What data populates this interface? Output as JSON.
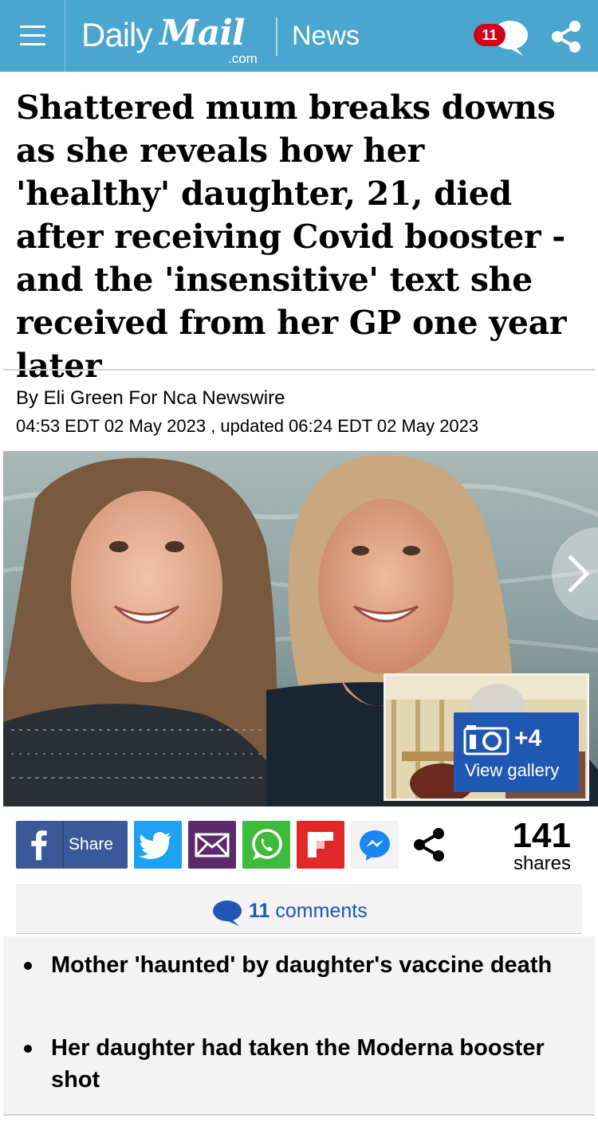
{
  "header": {
    "logo_daily": "Daily",
    "logo_mail": "Mail",
    "logo_com": ".com",
    "section": "News",
    "comment_count": "11",
    "brand_color": "#4aa6cf"
  },
  "article": {
    "headline": "Shattered mum breaks downs as she reveals how her 'healthy' daughter, 21, died after receiving Covid booster - and the 'insensitive' text she received from her GP one year later",
    "byline": "By Eli Green For Nca Newswire",
    "dateline": "04:53 EDT 02 May 2023 , updated 06:24 EDT 02 May 2023"
  },
  "gallery": {
    "extra_count": "+4",
    "label": "View gallery"
  },
  "share_bar": {
    "facebook_label": "Share",
    "share_count": "141",
    "share_word": "shares",
    "icons": [
      "facebook-icon",
      "twitter-icon",
      "email-icon",
      "whatsapp-icon",
      "flipboard-icon",
      "messenger-icon",
      "share-icon"
    ]
  },
  "comments": {
    "count": "11",
    "word": "comments"
  },
  "bullets": [
    "Mother 'haunted' by daughter's vaccine death",
    "Her daughter had taken the Moderna booster shot"
  ]
}
